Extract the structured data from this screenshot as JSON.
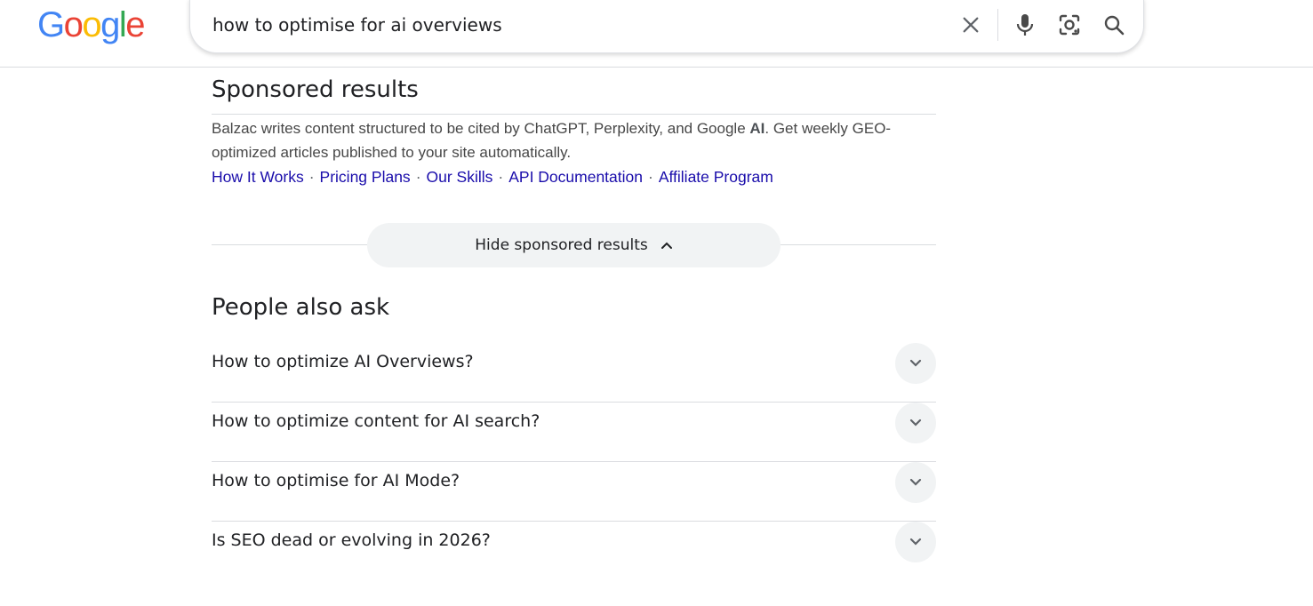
{
  "header": {
    "logo_letters": [
      "G",
      "o",
      "o",
      "g",
      "l",
      "e"
    ],
    "logo_colors": [
      "#4285F4",
      "#EA4335",
      "#FBBC05",
      "#4285F4",
      "#34A853",
      "#EA4335"
    ],
    "search": {
      "query": "how to optimise for ai overviews",
      "icons": [
        "close-icon",
        "microphone-icon",
        "lens-camera-icon",
        "search-icon"
      ]
    }
  },
  "sponsored": {
    "title": "Sponsored results",
    "description_before": "Balzac writes content structured to be cited by ChatGPT, Perplexity, and Google ",
    "description_bold": "AI",
    "description_after": ". Get weekly GEO-optimized articles published to your site automatically.",
    "sitelinks": [
      "How It Works",
      "Pricing Plans",
      "Our Skills",
      "API Documentation",
      "Affiliate Program"
    ],
    "separator": "·",
    "hide_label": "Hide sponsored results"
  },
  "people_also_ask": {
    "title": "People also ask",
    "questions": [
      "How to optimize AI Overviews?",
      "How to optimize content for AI search?",
      "How to optimise for AI Mode?",
      "Is SEO dead or evolving in 2026?"
    ]
  },
  "colors": {
    "link": "#1a0dab",
    "chip_bg": "#f1f3f4",
    "divider": "#dadce0",
    "text": "#202124"
  }
}
